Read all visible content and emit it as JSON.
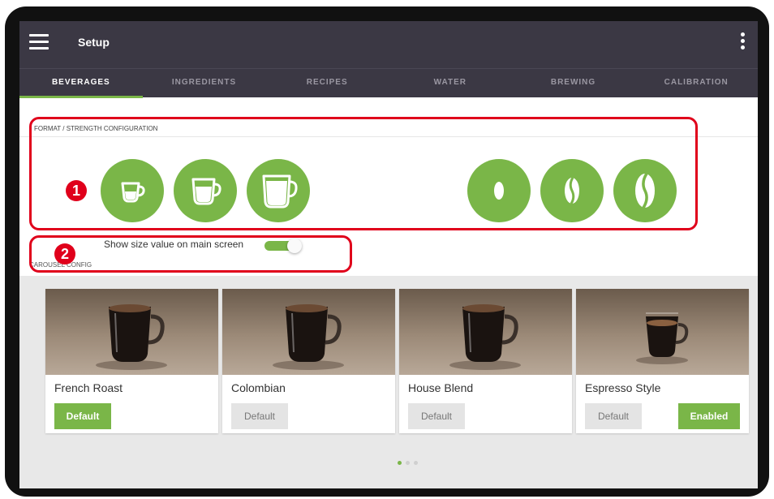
{
  "app": {
    "title": "Setup",
    "menu_icon": "hamburger-menu-icon",
    "overflow_icon": "kebab-menu-icon"
  },
  "tabs": [
    {
      "label": "BEVERAGES",
      "active": true
    },
    {
      "label": "INGREDIENTS",
      "active": false
    },
    {
      "label": "RECIPES",
      "active": false
    },
    {
      "label": "WATER",
      "active": false
    },
    {
      "label": "BREWING",
      "active": false
    },
    {
      "label": "CALIBRATION",
      "active": false
    }
  ],
  "format_section": {
    "label": "FORMAT / STRENGTH CONFIGURATION",
    "size_icons": [
      "cup-small-icon",
      "cup-medium-icon",
      "cup-large-icon"
    ],
    "strength_icons": [
      "bean-mild-icon",
      "bean-medium-icon",
      "bean-strong-icon"
    ]
  },
  "toggle": {
    "label": "Show size value on main screen",
    "on": true
  },
  "carousel": {
    "label": "CAROUSEL CONFIG",
    "cards": [
      {
        "name": "French Roast",
        "default_label": "Default",
        "default_active": true
      },
      {
        "name": "Colombian",
        "default_label": "Default",
        "default_active": false
      },
      {
        "name": "House Blend",
        "default_label": "Default",
        "default_active": false
      },
      {
        "name": "Espresso Style",
        "default_label": "Default",
        "default_active": false,
        "enabled_label": "Enabled"
      }
    ],
    "page_count": 3,
    "current_page": 1
  },
  "annotations": [
    {
      "number": "1"
    },
    {
      "number": "2"
    }
  ],
  "colors": {
    "accent": "#7ab648",
    "appbar": "#3b3844",
    "annotation": "#e0001b"
  }
}
